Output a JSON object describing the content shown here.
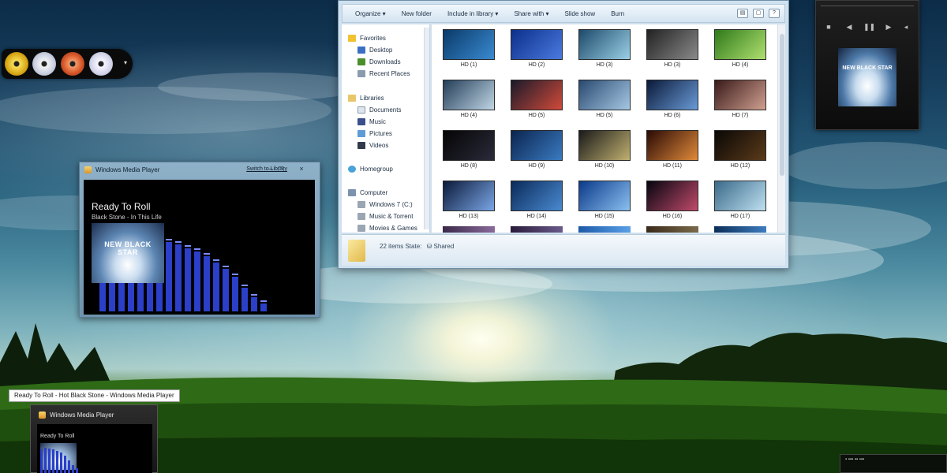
{
  "explorer": {
    "toolbar": [
      "Organize ▾",
      "New folder",
      "Include in library ▾",
      "Share with ▾",
      "Slide show",
      "Burn"
    ],
    "nav": {
      "favorites": "Favorites",
      "favorites_items": [
        "Desktop",
        "Downloads",
        "Recent Places"
      ],
      "libraries": "Libraries",
      "libraries_items": [
        "Documents",
        "Music",
        "Pictures",
        "Videos"
      ],
      "homegroup": "Homegroup",
      "computer": "Computer",
      "computer_items": [
        "Windows 7 (C:)",
        "Music & Torrent",
        "Movies & Games"
      ]
    },
    "thumbnails": [
      "HD (1)",
      "HD (2)",
      "HD (3)",
      "HD (3)",
      "HD (4)",
      "HD (4)",
      "HD (5)",
      "HD (5)",
      "HD (6)",
      "HD (7)",
      "HD (8)",
      "HD (9)",
      "HD (10)",
      "HD (11)",
      "HD (12)",
      "HD (13)",
      "HD (14)",
      "HD (15)",
      "HD (16)",
      "HD (17)"
    ],
    "status": "22 items   State:",
    "shared_label": "Shared"
  },
  "wmp": {
    "title": "Windows Media Player",
    "switch_label": "Switch to Library",
    "song": "Ready To Roll",
    "artist": "Black Stone - In This Life",
    "art_text": "NEW BLACK STAR"
  },
  "taskbar": {
    "tooltip": "Ready To Roll - Hot Black Stone - Windows Media Player",
    "preview_title": "Windows Media Player",
    "preview_song": "Ready To Roll"
  },
  "mini_player": {
    "art_text": "NEW BLACK STAR"
  },
  "colors": {
    "wmp_bar": "#2b3fc9",
    "wmp_bar_top": "#7a8cff",
    "window_frame": "#cfe0ee"
  }
}
